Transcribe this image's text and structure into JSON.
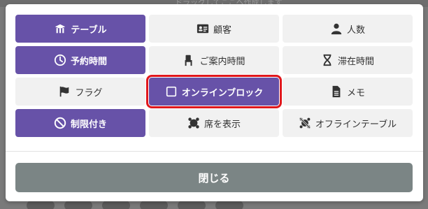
{
  "background": {
    "hint_text": "ドラッグしてここへ作成します"
  },
  "buttons": [
    {
      "label": "テーブル",
      "icon": "table-icon",
      "active": true
    },
    {
      "label": "顧客",
      "icon": "id-card-icon",
      "active": false
    },
    {
      "label": "人数",
      "icon": "person-icon",
      "active": false
    },
    {
      "label": "予約時間",
      "icon": "clock-icon",
      "active": true
    },
    {
      "label": "ご案内時間",
      "icon": "chair-icon",
      "active": false
    },
    {
      "label": "滞在時間",
      "icon": "hourglass-icon",
      "active": false
    },
    {
      "label": "フラグ",
      "icon": "flag-icon",
      "active": false
    },
    {
      "label": "オンラインブロック",
      "icon": "checkbox-icon",
      "active": true,
      "highlighted": true
    },
    {
      "label": "メモ",
      "icon": "file-icon",
      "active": false
    },
    {
      "label": "制限付き",
      "icon": "ban-icon",
      "active": true
    },
    {
      "label": "席を表示",
      "icon": "seat-icon",
      "active": false
    },
    {
      "label": "オフラインテーブル",
      "icon": "offline-table-icon",
      "active": false
    }
  ],
  "close_label": "閉じる",
  "colors": {
    "active": "#6752a8",
    "inactive": "#f1f1f1",
    "highlight": "#e0171c",
    "close": "#7b8585"
  }
}
